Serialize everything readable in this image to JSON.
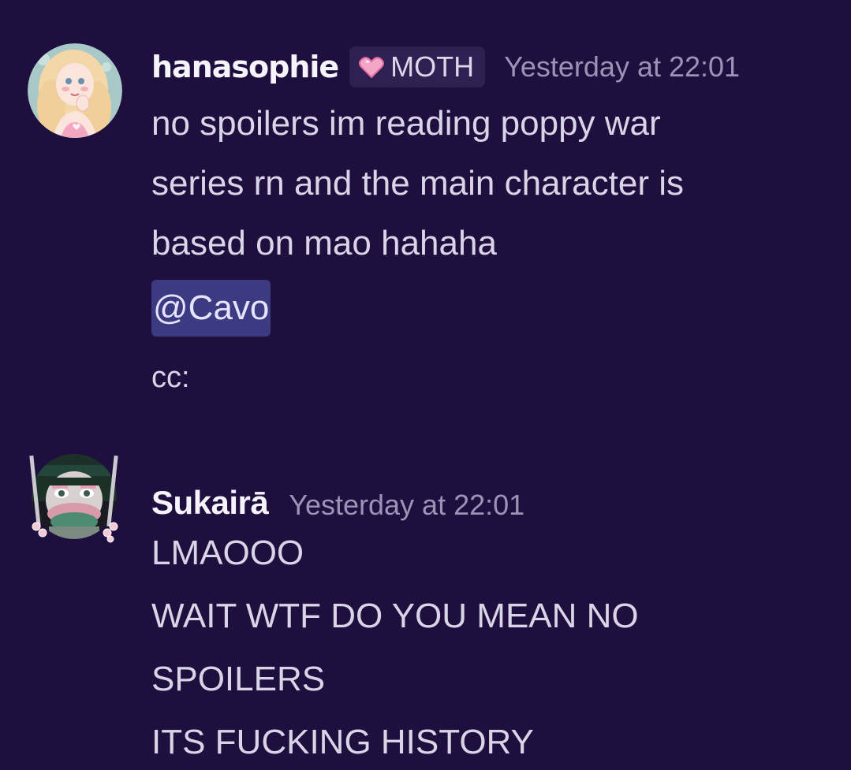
{
  "messages": [
    {
      "username": "hanasophie",
      "role_tag": "MOTH",
      "role_icon": "pink-heart-icon",
      "timestamp": "Yesterday at 22:01",
      "lines": [
        "no spoilers im reading poppy war",
        "series rn and the main character is",
        "based on mao hahaha"
      ],
      "mention": "@Cavo",
      "trailing": "cc:"
    },
    {
      "username": "Sukairā",
      "timestamp": "Yesterday at 22:01",
      "lines": [
        "LMAOOO",
        "WAIT WTF DO YOU MEAN NO",
        "SPOILERS",
        "ITS FUCKING HISTORY"
      ]
    }
  ],
  "colors": {
    "background": "#1f0f3f",
    "username": "#f6f4fb",
    "timestamp": "#9c93b6",
    "text": "#d9d4e6",
    "mention_bg": "#3c3a80",
    "role_tag_bg": "#2e2050",
    "heart": "#f08ab8"
  }
}
